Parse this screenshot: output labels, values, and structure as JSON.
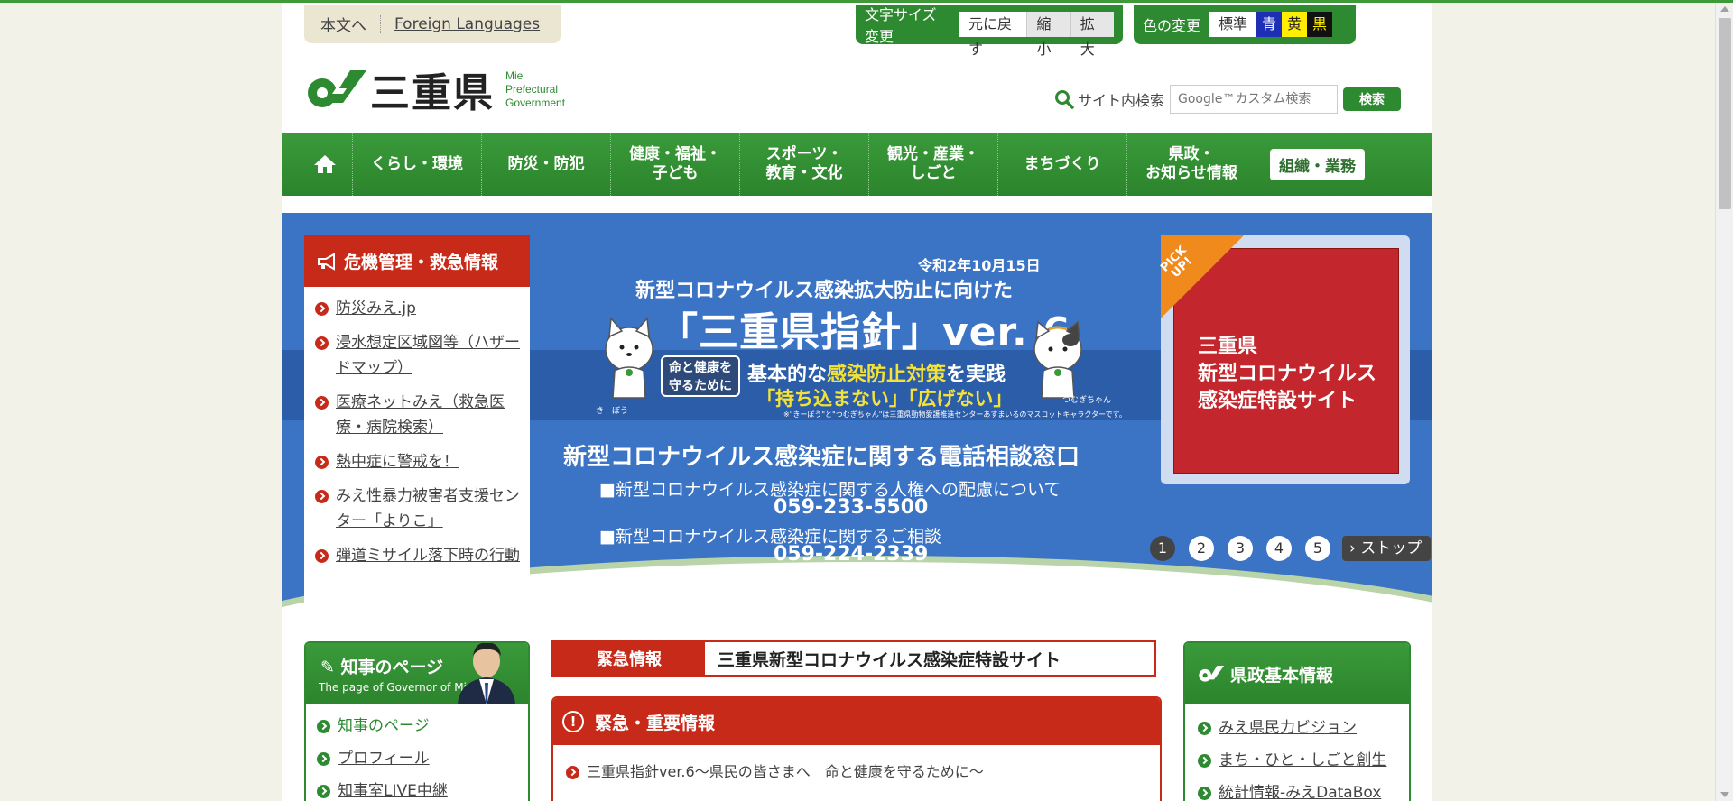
{
  "skip": {
    "main_text": "本文へ",
    "foreign": "Foreign Languages"
  },
  "text_size": {
    "label": "文字サイズ変更",
    "reset": "元に戻す",
    "smaller": "縮小",
    "larger": "拡大"
  },
  "color_change": {
    "label": "色の変更",
    "standard": "標準",
    "blue": "青",
    "yellow": "黄",
    "black": "黒"
  },
  "logo": {
    "name": "三重県",
    "en_line1": "Mie",
    "en_line2": "Prefectural",
    "en_line3": "Government"
  },
  "search": {
    "label": "サイト内検索",
    "placeholder": "Google™カスタム検索",
    "button": "検索"
  },
  "nav": {
    "home_icon": "home-icon",
    "items": [
      {
        "line1": "くらし・環境",
        "line2": ""
      },
      {
        "line1": "防災・防犯",
        "line2": ""
      },
      {
        "line1": "健康・福祉・",
        "line2": "子ども"
      },
      {
        "line1": "スポーツ・",
        "line2": "教育・文化"
      },
      {
        "line1": "観光・産業・",
        "line2": "しごと"
      },
      {
        "line1": "まちづくり",
        "line2": ""
      },
      {
        "line1": "県政・",
        "line2": "お知らせ情報"
      }
    ],
    "org": "組織・業務"
  },
  "crisis": {
    "title": "危機管理・救急情報",
    "links": [
      "防災みえ.jp",
      "浸水想定区域図等（ハザードマップ）",
      "医療ネットみえ（救急医療・病院検索）",
      "熱中症に警戒を！",
      "みえ性暴力被害者支援センター「よりこ」",
      "弾道ミサイル落下時の行動"
    ]
  },
  "banner": {
    "date": "令和2年10月15日",
    "line1": "新型コロナウイルス感染拡大防止に向けた",
    "line2": "「三重県指針」ver. 6",
    "badge1": "命と健康を",
    "badge2": "守るために",
    "line3_a": "基本的な",
    "line3_b": "感染防止対策",
    "line3_c": "を実践",
    "line4": "「持ち込まない」「広げない」",
    "note": "※\"きーぼう\"と\"つむぎちゃん\"は三重県動物愛護推進センターあすまいるのマスコットキャラクターです。",
    "mascot1": "きーぼう",
    "mascot2": "つむぎちゃん",
    "line5": "新型コロナウイルス感染症に関する電話相談窓口",
    "line6": "■新型コロナウイルス感染症に関する人権への配慮について",
    "phone1": "059-233-5500",
    "line8": "■新型コロナウイルス感染症に関するご相談",
    "phone2": "059-224-2339"
  },
  "pickup": {
    "tag1": "PICK",
    "tag2": "UP!",
    "line1": "三重県",
    "line2": "新型コロナウイルス",
    "line3": "感染症特設サイト"
  },
  "pager": {
    "pages": [
      "1",
      "2",
      "3",
      "4",
      "5"
    ],
    "active": 1,
    "stop": "ストップ"
  },
  "governor": {
    "title": "知事のページ",
    "subtitle": "The page of Governor of Mie",
    "links": [
      "知事のページ",
      "プロフィール",
      "知事室LIVE中継"
    ]
  },
  "emergency": {
    "label": "緊急情報",
    "link": "三重県新型コロナウイルス感染症特設サイト"
  },
  "important": {
    "title": "緊急・重要情報",
    "icon": "!",
    "items": [
      "三重県指針ver.6～県民の皆さまへ　命と健康を守るために～"
    ]
  },
  "kensei": {
    "title": "県政基本情報",
    "links": [
      "みえ県民力ビジョン",
      "まち・ひと・しごと創生",
      "統計情報-みえDataBox"
    ]
  },
  "colors": {
    "green": "#2e8a31",
    "red": "#c82a1a",
    "blue": "#3b73c5",
    "orange": "#f08a1c"
  }
}
